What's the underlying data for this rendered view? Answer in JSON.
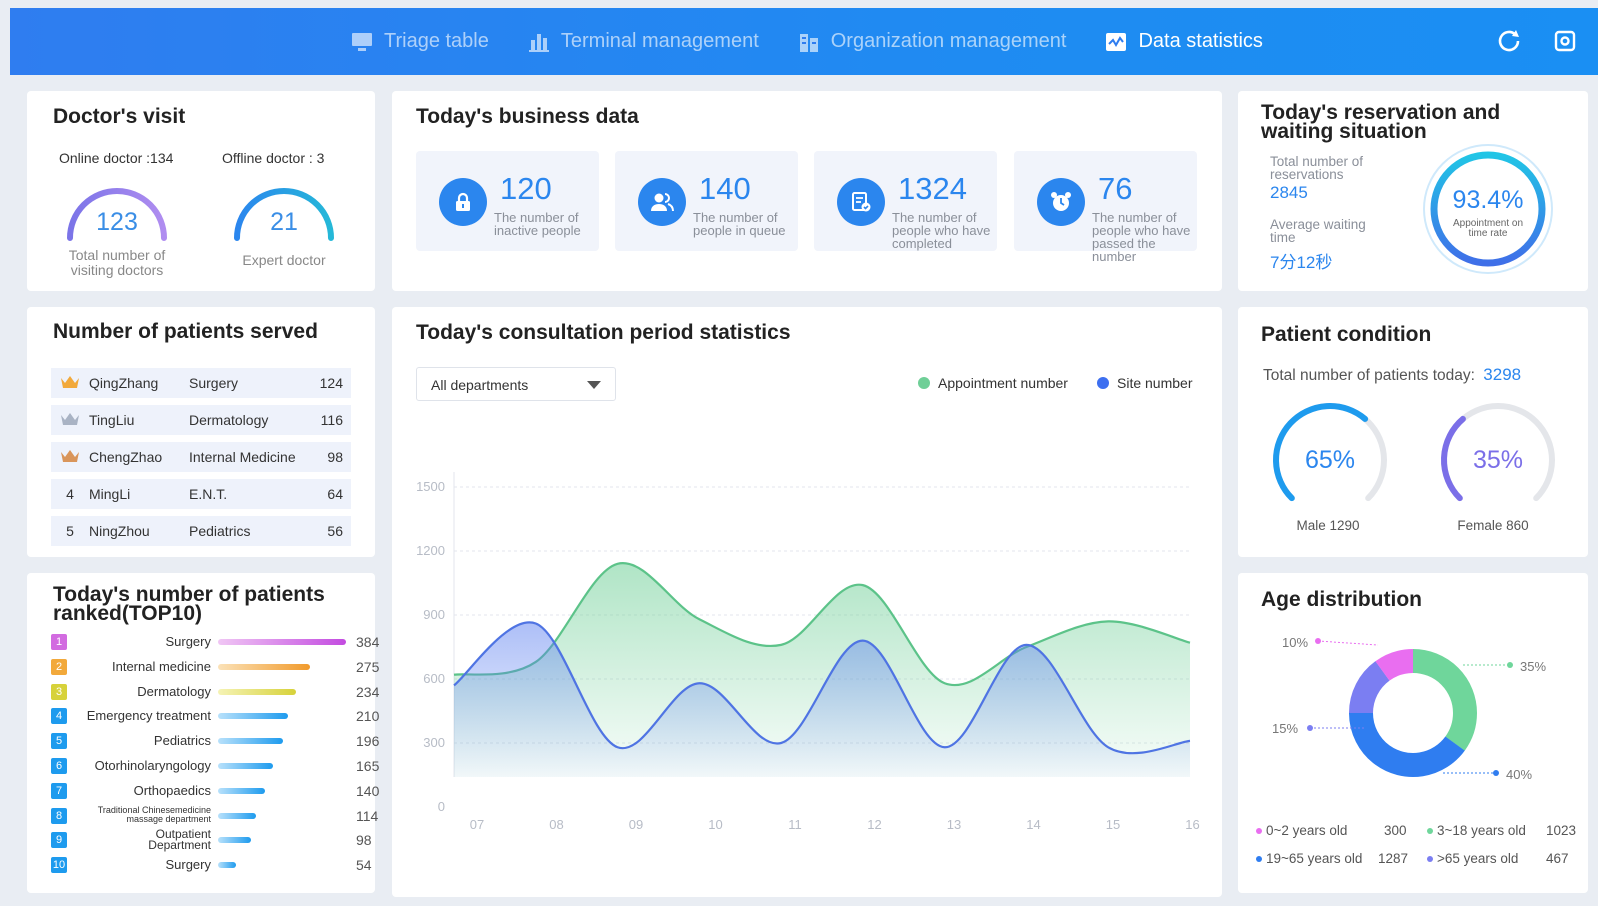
{
  "nav": {
    "items": [
      {
        "label": "Triage table",
        "icon": "monitor-icon"
      },
      {
        "label": "Terminal management",
        "icon": "bar-chart-icon"
      },
      {
        "label": "Organization management",
        "icon": "building-icon"
      },
      {
        "label": "Data statistics",
        "icon": "stats-icon",
        "active": true
      }
    ],
    "accent": "#2f7df0"
  },
  "doctors": {
    "title": "Doctor's visit",
    "online_label": "Online doctor :134",
    "offline_label": "Offline doctor : 3",
    "total_value": "123",
    "total_caption": "Total number of visiting doctors",
    "expert_value": "21",
    "expert_caption": "Expert doctor"
  },
  "business": {
    "title": "Today's business data",
    "tiles": [
      {
        "value": "120",
        "caption": "The number of inactive people",
        "icon": "lock-icon"
      },
      {
        "value": "140",
        "caption": "The number of people in queue",
        "icon": "users-icon"
      },
      {
        "value": "1324",
        "caption": "The number of people who have completed",
        "icon": "document-check-icon"
      },
      {
        "value": "76",
        "caption": "The number of people who have passed the number",
        "icon": "alarm-clock-icon"
      }
    ]
  },
  "reservation": {
    "title": "Today's reservation and waiting situation",
    "total_label": "Total number of reservations",
    "total_value": "2845",
    "avg_label": "Average waiting time",
    "avg_value": "7分12秒",
    "rate_value": "93.4%",
    "rate_label": "Appointment on time rate"
  },
  "served": {
    "title": "Number of patients served",
    "rows": [
      {
        "rank": "",
        "name": "QingZhang",
        "dept": "Surgery",
        "count": "124",
        "medal": "gold"
      },
      {
        "rank": "",
        "name": "TingLiu",
        "dept": "Dermatology",
        "count": "116",
        "medal": "silver"
      },
      {
        "rank": "",
        "name": "ChengZhao",
        "dept": "Internal Medicine",
        "count": "98",
        "medal": "bronze"
      },
      {
        "rank": "4",
        "name": "MingLi",
        "dept": "E.N.T.",
        "count": "64"
      },
      {
        "rank": "5",
        "name": "NingZhou",
        "dept": "Pediatrics",
        "count": "56"
      }
    ]
  },
  "top10": {
    "title": "Today's number of patients ranked(TOP10)",
    "rows": [
      {
        "rank": "1",
        "label": "Surgery",
        "value": 384
      },
      {
        "rank": "2",
        "label": "Internal medicine",
        "value": 275
      },
      {
        "rank": "3",
        "label": "Dermatology",
        "value": 234
      },
      {
        "rank": "4",
        "label": "Emergency treatment",
        "value": 210
      },
      {
        "rank": "5",
        "label": "Pediatrics",
        "value": 196
      },
      {
        "rank": "6",
        "label": "Otorhinolaryngology",
        "value": 165
      },
      {
        "rank": "7",
        "label": "Orthopaedics",
        "value": 140
      },
      {
        "rank": "8",
        "label": "Traditional Chinesemedicine massage department",
        "value": 114
      },
      {
        "rank": "9",
        "label": "Outpatient Department",
        "value": 98
      },
      {
        "rank": "10",
        "label": "Surgery",
        "value": 54
      }
    ]
  },
  "consult": {
    "title": "Today's consultation period statistics",
    "dropdown": "All departments"
  },
  "chart_data": {
    "type": "area",
    "title": "Today's consultation period statistics",
    "x": [
      "07",
      "08",
      "09",
      "10",
      "11",
      "12",
      "13",
      "14",
      "15",
      "16"
    ],
    "ylim": [
      0,
      1500
    ],
    "yticks": [
      0,
      300,
      600,
      900,
      1200,
      1500
    ],
    "grid": true,
    "legend": "top-right",
    "series": [
      {
        "name": "Appointment number",
        "color": "#5cc389",
        "values": [
          620,
          680,
          1140,
          880,
          760,
          1040,
          580,
          750,
          870,
          770
        ]
      },
      {
        "name": "Site number",
        "color": "#4f74e3",
        "values": [
          570,
          860,
          280,
          580,
          300,
          780,
          280,
          760,
          280,
          310
        ]
      }
    ]
  },
  "condition": {
    "title": "Patient condition",
    "total_label": "Total number of patients today:",
    "total_value": "3298",
    "male_pct": "65%",
    "male_label": "Male  1290",
    "female_pct": "35%",
    "female_label": "Female  860",
    "male_fraction": 0.65,
    "female_fraction": 0.35
  },
  "age": {
    "title": "Age distribution",
    "slices": [
      {
        "label": "0~2 years old",
        "value": "300",
        "pct": "10%",
        "color": "#e96ef0"
      },
      {
        "label": "3~18 years old",
        "value": "1023",
        "pct": "35%",
        "color": "#6fd69b"
      },
      {
        "label": "19~65 years old",
        "value": "1287",
        "pct": "40%",
        "color": "#2f7df0"
      },
      {
        "label": ">65 years old",
        "value": "467",
        "pct": "15%",
        "color": "#7b7ef2"
      }
    ]
  }
}
